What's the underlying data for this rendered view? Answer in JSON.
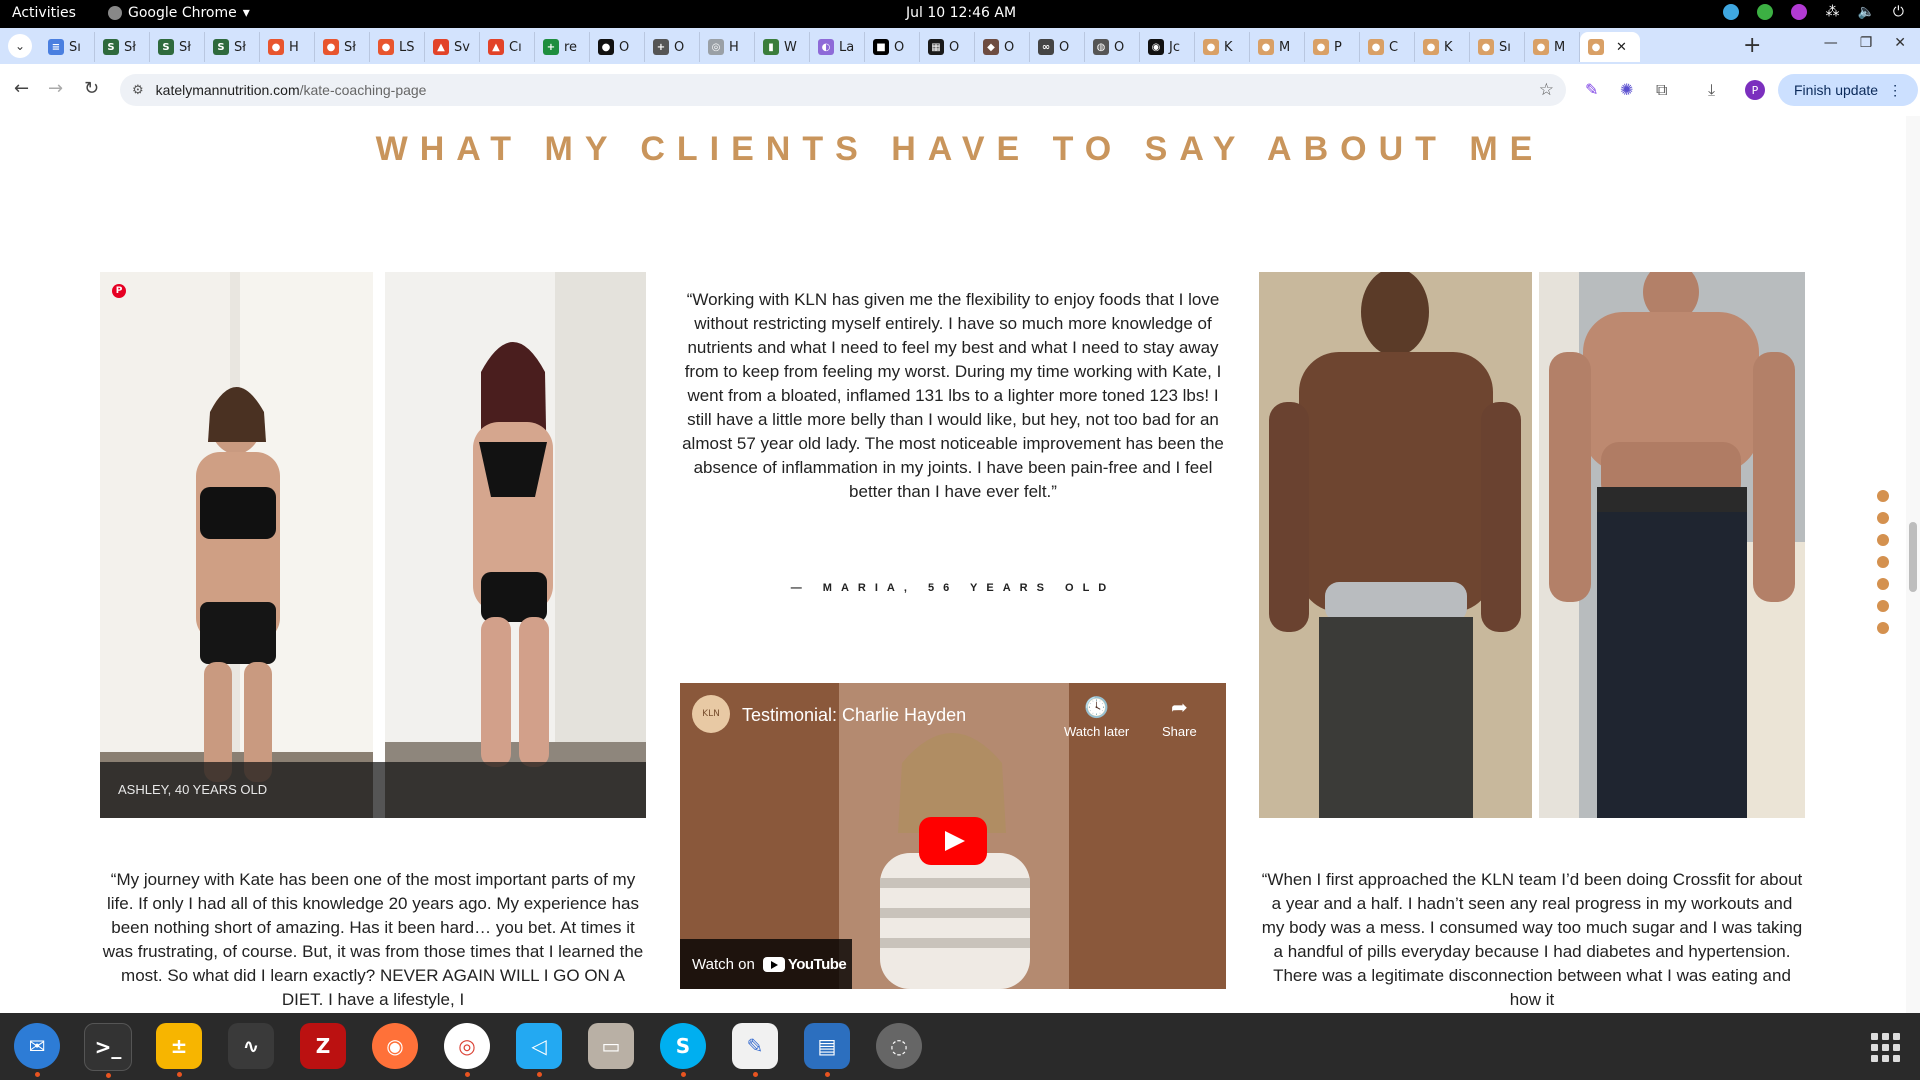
{
  "system_bar": {
    "activities": "Activities",
    "app_name": "Google Chrome",
    "clock": "Jul 10  12:46 AM"
  },
  "browser": {
    "tabs": [
      {
        "label": "Sı",
        "icon_color": "#4a7fe0",
        "glyph": "≡"
      },
      {
        "label": "Sł",
        "icon_color": "#2f6a3d",
        "glyph": "S"
      },
      {
        "label": "Sł",
        "icon_color": "#2f6a3d",
        "glyph": "S"
      },
      {
        "label": "Sł",
        "icon_color": "#2f6a3d",
        "glyph": "S"
      },
      {
        "label": "H",
        "icon_color": "#e8552e",
        "glyph": "●"
      },
      {
        "label": "Sł",
        "icon_color": "#e8552e",
        "glyph": "●"
      },
      {
        "label": "LS",
        "icon_color": "#e8552e",
        "glyph": "●"
      },
      {
        "label": "Sv",
        "icon_color": "#e24329",
        "glyph": "▲"
      },
      {
        "label": "Cı",
        "icon_color": "#e24329",
        "glyph": "▲"
      },
      {
        "label": "re",
        "icon_color": "#1e8e3e",
        "glyph": "+"
      },
      {
        "label": "O",
        "icon_color": "#111111",
        "glyph": "●"
      },
      {
        "label": "O",
        "icon_color": "#555555",
        "glyph": "+"
      },
      {
        "label": "H",
        "icon_color": "#9aa0a6",
        "glyph": "◎"
      },
      {
        "label": "W",
        "icon_color": "#3b7d3b",
        "glyph": "▮"
      },
      {
        "label": "La",
        "icon_color": "#8e6ad8",
        "glyph": "◐"
      },
      {
        "label": "O",
        "icon_color": "#000000",
        "glyph": "■"
      },
      {
        "label": "O",
        "icon_color": "#1a1a1a",
        "glyph": "▦"
      },
      {
        "label": "O",
        "icon_color": "#6d4c41",
        "glyph": "◆"
      },
      {
        "label": "O",
        "icon_color": "#444444",
        "glyph": "∞"
      },
      {
        "label": "O",
        "icon_color": "#555555",
        "glyph": "◍"
      },
      {
        "label": "Jc",
        "icon_color": "#111111",
        "glyph": "◉"
      },
      {
        "label": "K",
        "icon_color": "#d9a066",
        "glyph": "●"
      },
      {
        "label": "M",
        "icon_color": "#d9a066",
        "glyph": "●"
      },
      {
        "label": "P",
        "icon_color": "#d9a066",
        "glyph": "●"
      },
      {
        "label": "C",
        "icon_color": "#d9a066",
        "glyph": "●"
      },
      {
        "label": "K",
        "icon_color": "#d9a066",
        "glyph": "●"
      },
      {
        "label": "Sı",
        "icon_color": "#d9a066",
        "glyph": "●"
      },
      {
        "label": "M",
        "icon_color": "#d9a066",
        "glyph": "●"
      },
      {
        "label": "",
        "icon_color": "#d9a066",
        "glyph": "●",
        "active": true
      }
    ],
    "url_host": "katelymannutrition.com",
    "url_path": "/kate-coaching-page",
    "finish_update": "Finish update",
    "profile_initial": "P"
  },
  "page": {
    "heading": "WHAT MY CLIENTS HAVE TO SAY ABOUT ME",
    "caption_ashley": "ASHLEY, 40 YEARS OLD",
    "quote_maria": "“Working with KLN has given me the flexibility to enjoy foods that I love without restricting myself entirely. I have so much more knowledge of nutrients and what I need to feel my best and what I need to stay away from to keep from feeling my worst. During my time working with Kate, I went from a bloated, inflamed 131 lbs to a lighter more toned 123 lbs! I still have a little more belly than I would like, but hey, not too bad for an almost 57 year old lady. The most noticeable improvement has been the absence of inflammation in my joints. I have been pain-free and I feel better than I have ever felt.”",
    "attrib_maria": "— MARIA, 56 YEARS OLD",
    "quote_ashley": "“My journey with Kate has been one of the most important parts of my life. If only I had all of this knowledge 20 years ago. My experience has been nothing short of amazing. Has it been hard… you bet. At times it was frustrating, of course. But, it was from those times that I learned the most. So what did I learn exactly? NEVER AGAIN WILL I GO ON A DIET. I have a lifestyle, I",
    "quote_right": "“When I first approached the KLN team I’d been doing Crossfit for about a year and a half. I hadn’t seen any real progress in my workouts and my body was a mess. I consumed way too much sugar and I was taking a handful of pills everyday because I had diabetes and hypertension. There was a legitimate disconnection between what I was eating and how it",
    "video": {
      "title": "Testimonial: Charlie Hayden",
      "channel_badge": "KLN",
      "watch_later": "Watch later",
      "share": "Share",
      "watch_on": "Watch on",
      "youtube": "YouTube"
    }
  },
  "colors": {
    "accent": "#c9955c",
    "dots": "#d4914f"
  }
}
